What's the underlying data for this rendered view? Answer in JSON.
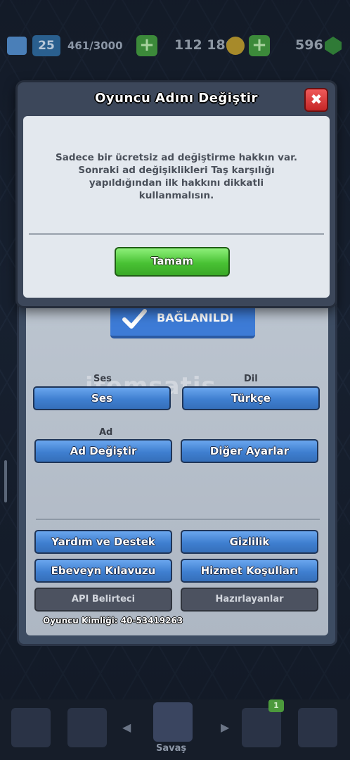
{
  "topbar": {
    "level": "25",
    "xp": "461/3000",
    "gold": "112 186",
    "gems": "596",
    "plus_symbol": "+"
  },
  "settings": {
    "connected_label": "BAĞLANILDI",
    "sound_label": "Ses",
    "sound_button": "Ses",
    "language_label": "Dil",
    "language_button": "Türkçe",
    "name_label": "Ad",
    "change_name_button": "Ad Değiştir",
    "other_settings_button": "Diğer Ayarlar",
    "help_button": "Yardım ve Destek",
    "privacy_button": "Gizlilik",
    "parents_guide_button": "Ebeveyn Kılavuzu",
    "terms_button": "Hizmet Koşulları",
    "api_token_button": "API Belirteci",
    "credits_button": "Hazırlayanlar",
    "player_id": "Oyuncu Kimliği: 40-53419263",
    "watermark": "itemsatis"
  },
  "dialog": {
    "title": "Oyuncu Adını Değiştir",
    "close_symbol": "✖",
    "message": "Sadece bir ücretsiz ad değiştirme hakkın var. Sonraki ad değişiklikleri Taş karşılığı yapıldığından ilk hakkını dikkatli kullanmalısın.",
    "ok_button": "Tamam"
  },
  "bottomnav": {
    "battle_label": "Savaş",
    "clan_badge": "1",
    "left_arrow": "◀",
    "right_arrow": "▶"
  }
}
